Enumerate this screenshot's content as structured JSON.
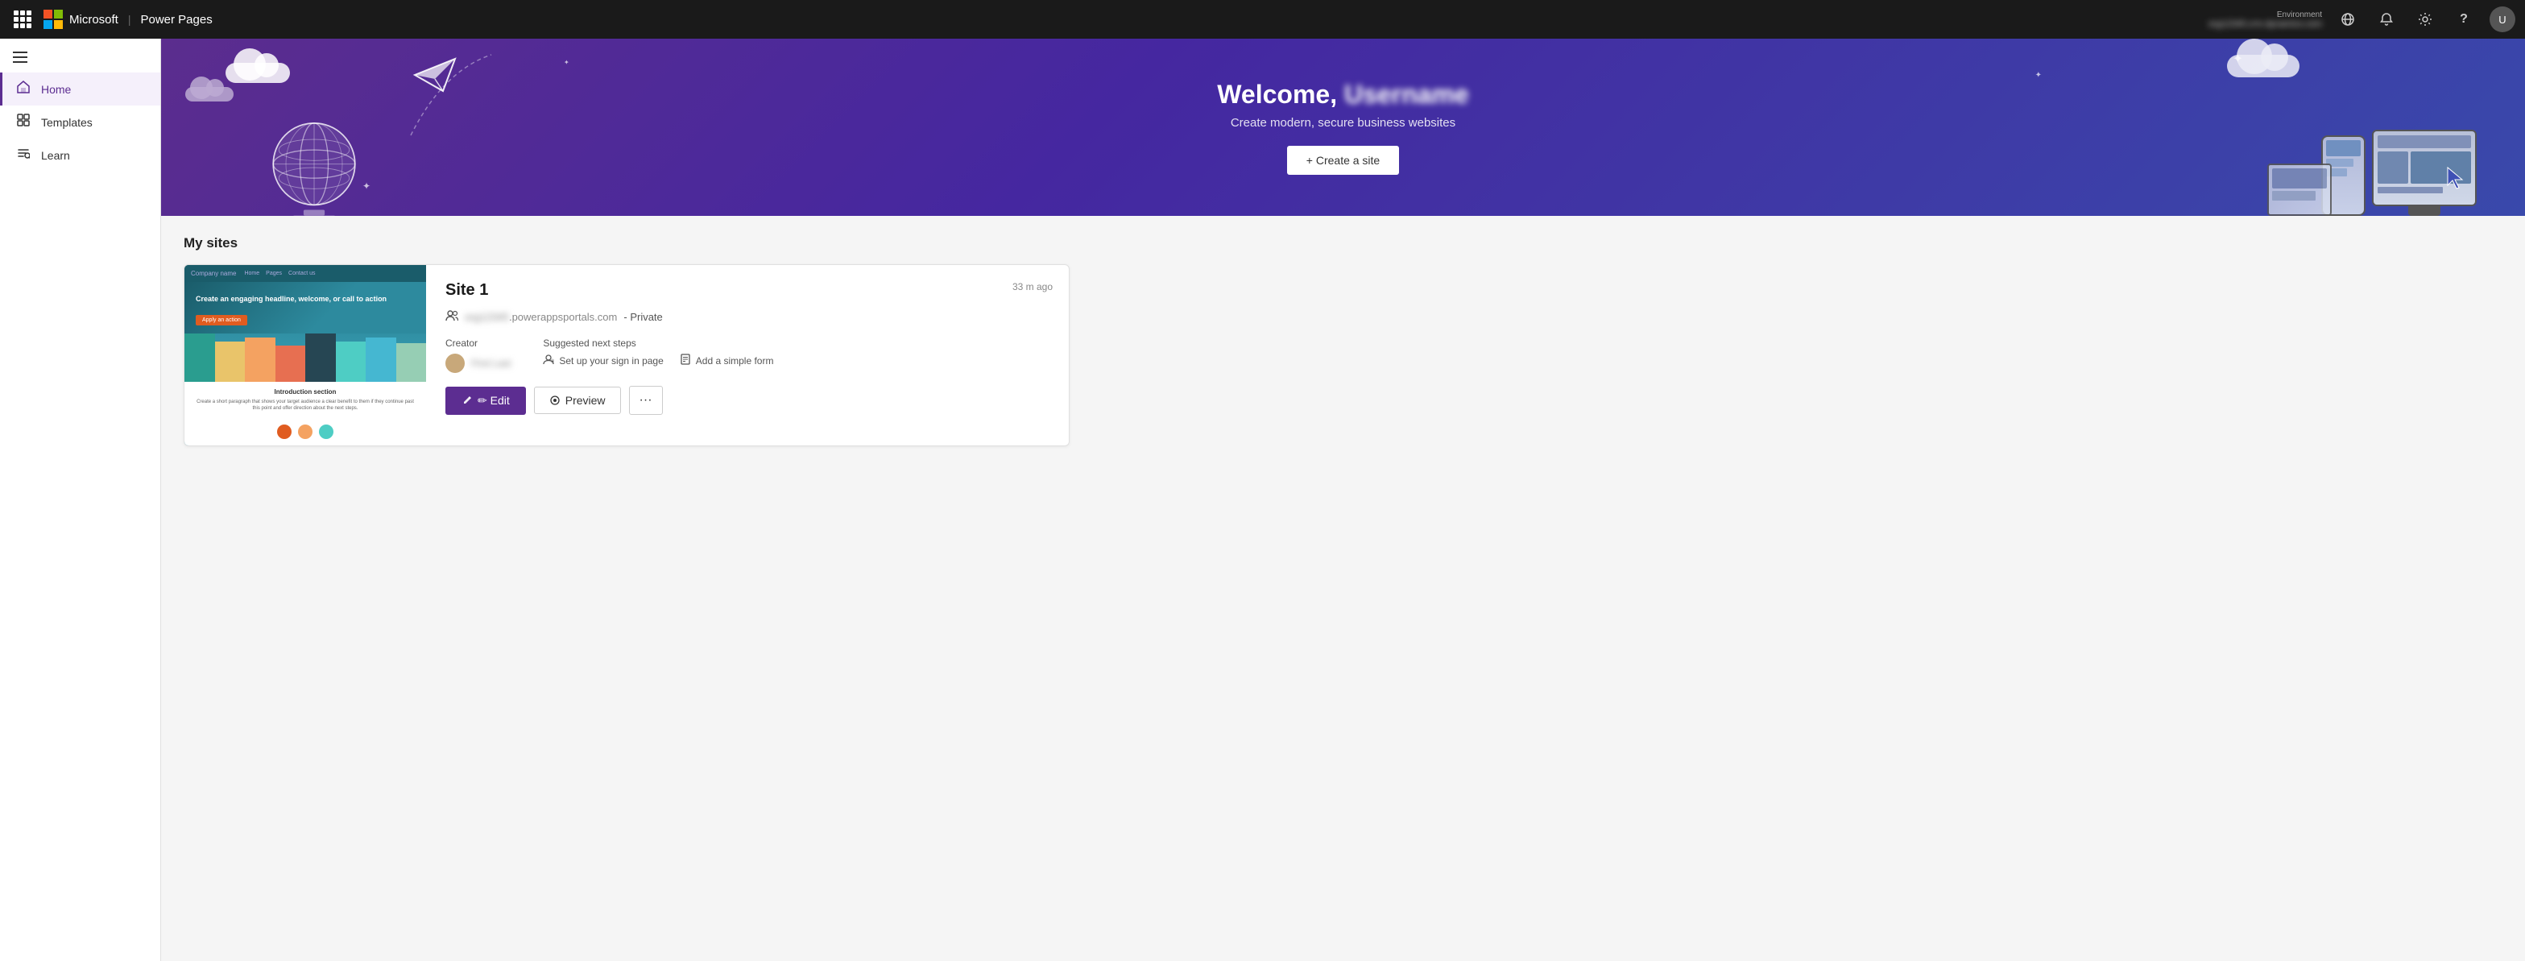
{
  "app": {
    "name": "Power Pages",
    "brand": "Microsoft"
  },
  "topnav": {
    "environment_label": "Environment",
    "environment_value": "••••••••••••••••••",
    "bell_icon": "🔔",
    "settings_icon": "⚙",
    "help_icon": "?",
    "avatar_initials": "U"
  },
  "sidebar": {
    "items": [
      {
        "id": "home",
        "label": "Home",
        "icon": "🏠",
        "active": true
      },
      {
        "id": "templates",
        "label": "Templates",
        "icon": "⊞"
      },
      {
        "id": "learn",
        "label": "Learn",
        "icon": "📖"
      }
    ]
  },
  "hero": {
    "title": "Welcome,",
    "username": "••••••",
    "subtitle": "Create modern, secure business websites",
    "cta_label": "+ Create a site"
  },
  "sites_section": {
    "title": "My sites",
    "sites": [
      {
        "id": "site1",
        "name": "Site 1",
        "url_prefix": "••••••••",
        "url_domain": ".powerappsportals.com",
        "privacy": "Private",
        "creator_name": "•••••• ••••••",
        "timestamp": "33 m ago",
        "suggested_steps": [
          {
            "id": "sign-in",
            "label": "Set up your sign in page",
            "icon": "👤"
          },
          {
            "id": "form",
            "label": "Add a simple form",
            "icon": "📋"
          }
        ],
        "preview": {
          "company_name": "Company name",
          "nav_links": [
            "Home",
            "Pages",
            "Contact us"
          ],
          "headline": "Create an engaging headline, welcome, or call to action",
          "cta_btn": "Apply an action",
          "intro_title": "Introduction section",
          "intro_text": "Create a short paragraph that shows your target audience a clear benefit to them if they continue past this point and offer direction about the next steps."
        }
      }
    ]
  },
  "actions": {
    "edit_label": "✏ Edit",
    "preview_label": "◎ Preview",
    "more_label": "···"
  },
  "meta": {
    "creator_label": "Creator",
    "next_steps_label": "Suggested next steps"
  }
}
